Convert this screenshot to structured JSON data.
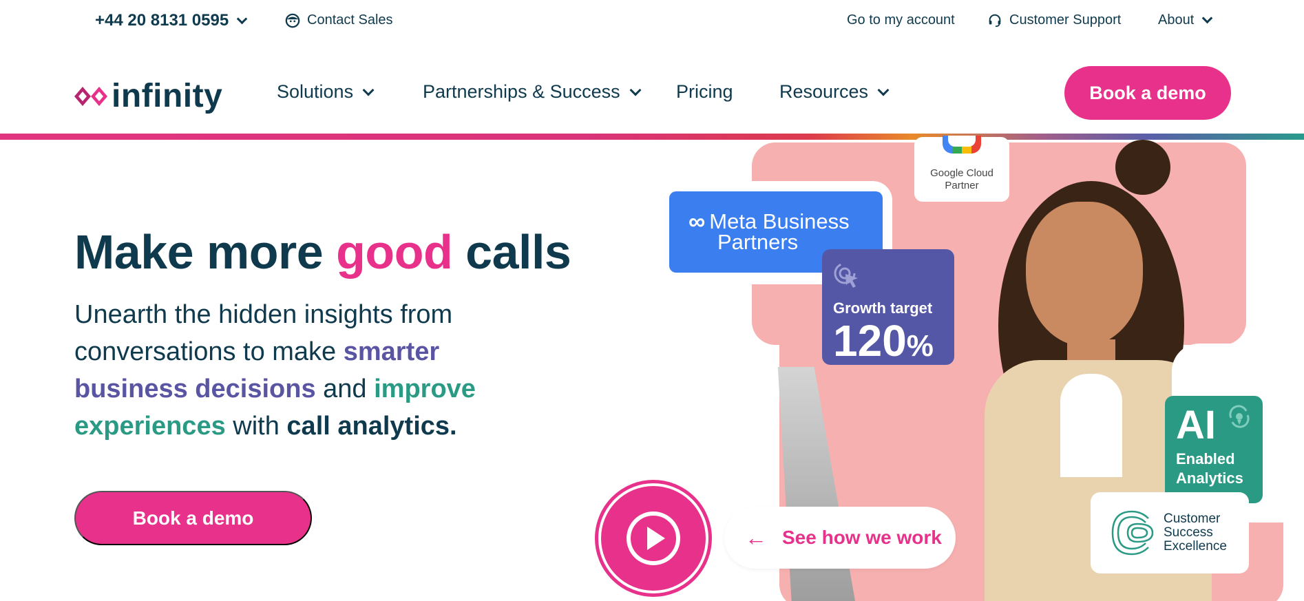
{
  "topbar": {
    "phone": "+44 20 8131 0595",
    "contact_sales": "Contact Sales",
    "account": "Go to my account",
    "support": "Customer Support",
    "about": "About"
  },
  "nav": {
    "logo": "infinity",
    "solutions": "Solutions",
    "partnerships": "Partnerships & Success",
    "pricing": "Pricing",
    "resources": "Resources",
    "book_demo": "Book a demo"
  },
  "hero": {
    "title_a": "Make more ",
    "title_b": "good",
    "title_c": " calls",
    "sub_1": "Unearth the hidden insights from conversations to make ",
    "sub_2": "smarter business decisions",
    "sub_3": " and ",
    "sub_4": "improve experiences",
    "sub_5": " with ",
    "sub_6": "call analytics.",
    "book_demo": "Book a demo"
  },
  "art": {
    "google_l1": "Google Cloud",
    "google_l2": "Partner",
    "meta_l1": "Meta Business",
    "meta_l2": "Partners",
    "growth_label": "Growth target",
    "growth_value": "120",
    "growth_unit": "%",
    "ai_big": "AI",
    "ai_l1": "Enabled",
    "ai_l2": "Analytics",
    "cse_l1": "Customer",
    "cse_l2": "Success",
    "cse_l3": "Excellence",
    "see_how": "See how we work"
  },
  "colors": {
    "brand_pink": "#e8318a",
    "navy": "#0f3a4d",
    "purple": "#5a55a3",
    "teal": "#2b9a85",
    "meta_blue": "#3a7ef0"
  }
}
